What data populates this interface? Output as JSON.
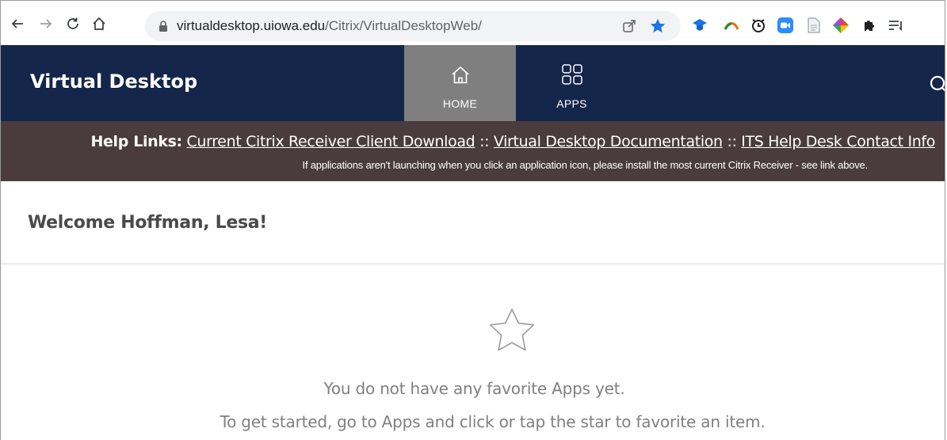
{
  "browser": {
    "url_domain": "virtualdesktop.uiowa.edu",
    "url_path": "/Citrix/VirtualDesktopWeb/",
    "colors": {
      "star": "#1a73e8",
      "toolbar_bg": "#ffffff",
      "omnibox_bg": "#f1f3f4"
    },
    "icons": [
      "back-icon",
      "forward-icon",
      "reload-icon",
      "home-icon",
      "lock-icon",
      "share-icon",
      "bookmark-star-icon",
      "extension-icons",
      "puzzle-icon",
      "reading-list-icon"
    ]
  },
  "header": {
    "brand": "Virtual Desktop",
    "tabs": [
      {
        "label": "HOME",
        "icon": "home-icon",
        "active": true
      },
      {
        "label": "APPS",
        "icon": "apps-grid-icon",
        "active": false
      }
    ],
    "colors": {
      "bg": "#14264a",
      "active_tab": "#7f7f7f"
    }
  },
  "helpbar": {
    "label": "Help Links:",
    "links": [
      "Current Citrix Receiver Client Download",
      "Virtual Desktop Documentation",
      "ITS Help Desk Contact Info"
    ],
    "separator": "::",
    "note": "If applications aren't launching when you click an application icon, please install the most current Citrix Receiver - see link above.",
    "colors": {
      "bg": "#4a3b3e"
    }
  },
  "main": {
    "welcome": "Welcome Hoffman, Lesa!",
    "empty_title": "You do not have any favorite Apps yet.",
    "empty_hint": "To get started, go to Apps and click or tap the star to favorite an item."
  }
}
